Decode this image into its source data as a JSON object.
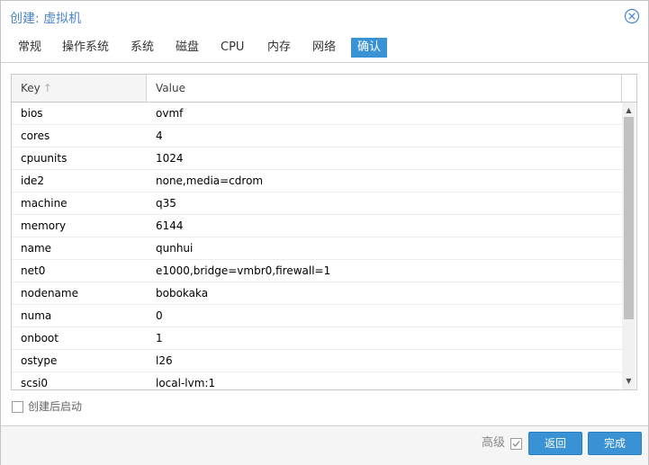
{
  "window": {
    "title": "创建: 虚拟机",
    "close_icon": "close-icon"
  },
  "tabs": [
    {
      "label": "常规",
      "active": false
    },
    {
      "label": "操作系统",
      "active": false
    },
    {
      "label": "系统",
      "active": false
    },
    {
      "label": "磁盘",
      "active": false
    },
    {
      "label": "CPU",
      "active": false
    },
    {
      "label": "内存",
      "active": false
    },
    {
      "label": "网络",
      "active": false
    },
    {
      "label": "确认",
      "active": true
    }
  ],
  "grid": {
    "columns": {
      "key": "Key",
      "value": "Value"
    },
    "sort_icon": "sort-ascending-icon",
    "rows": [
      {
        "key": "bios",
        "value": "ovmf"
      },
      {
        "key": "cores",
        "value": "4"
      },
      {
        "key": "cpuunits",
        "value": "1024"
      },
      {
        "key": "ide2",
        "value": "none,media=cdrom"
      },
      {
        "key": "machine",
        "value": "q35"
      },
      {
        "key": "memory",
        "value": "6144"
      },
      {
        "key": "name",
        "value": "qunhui"
      },
      {
        "key": "net0",
        "value": "e1000,bridge=vmbr0,firewall=1"
      },
      {
        "key": "nodename",
        "value": "bobokaka"
      },
      {
        "key": "numa",
        "value": "0"
      },
      {
        "key": "onboot",
        "value": "1"
      },
      {
        "key": "ostype",
        "value": "l26"
      },
      {
        "key": "scsi0",
        "value": "local-lvm:1"
      }
    ]
  },
  "start_after_create": {
    "label": "创建后启动",
    "checked": false
  },
  "footer": {
    "advanced_label": "高级",
    "advanced_checked": true,
    "back_label": "返回",
    "finish_label": "完成"
  },
  "colors": {
    "accent": "#3892d4",
    "title": "#4d85c8"
  }
}
